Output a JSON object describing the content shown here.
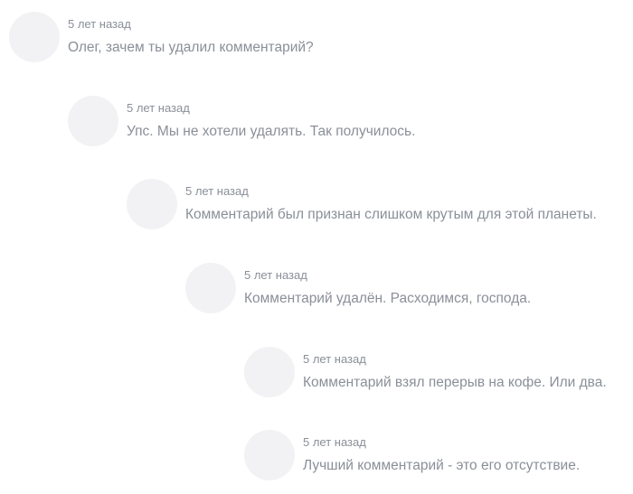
{
  "comments": [
    {
      "time": "5 лет назад",
      "text": "Олег, зачем ты удалил комментарий?"
    },
    {
      "time": "5 лет назад",
      "text": "Упс. Мы не хотели удалять. Так получилось."
    },
    {
      "time": "5 лет назад",
      "text": "Комментарий был признан слишком крутым для этой планеты."
    },
    {
      "time": "5 лет назад",
      "text": "Комментарий удалён. Расходимся, господа."
    },
    {
      "time": "5 лет назад",
      "text": "Комментарий взял перерыв на кофе. Или два."
    },
    {
      "time": "5 лет назад",
      "text": "Лучший комментарий - это его отсутствие."
    }
  ]
}
